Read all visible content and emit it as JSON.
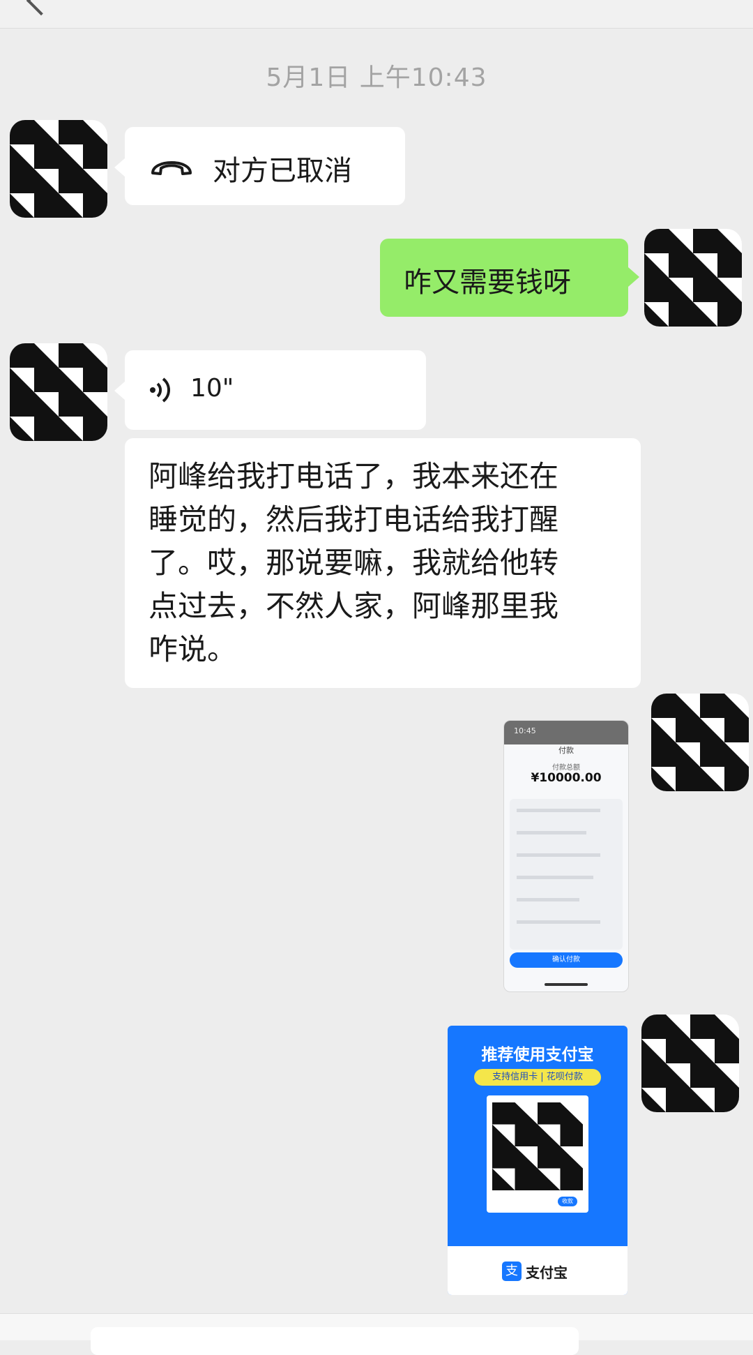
{
  "chat": {
    "timestamp": "5月1日 上午10:43",
    "call_cancelled_text": "对方已取消",
    "outgoing_message": "咋又需要钱呀",
    "voice_duration": "10\"",
    "long_message_lines": [
      "阿峰给我打电话了，我本来还在",
      "睡觉的，然后我打电话给我打醒",
      "了。哎，那说要嘛，我就给他转",
      "点过去，不然人家，阿峰那里我",
      "咋说。"
    ]
  },
  "payment_screenshot": {
    "status_time": "10:45",
    "title": "付款",
    "subtitle": "付款总额",
    "amount": "¥10000.00",
    "confirm_button": "确认付款"
  },
  "alipay_card": {
    "heading": "推荐使用支付宝",
    "banner": "支持信用卡 | 花呗付款",
    "brand": "支付宝",
    "footer_tag": "收款"
  },
  "colors": {
    "background": "#ededed",
    "outgoing_bubble": "#95ec69",
    "incoming_bubble": "#ffffff",
    "alipay_blue": "#1677ff",
    "banner_yellow": "#f4e64a"
  }
}
